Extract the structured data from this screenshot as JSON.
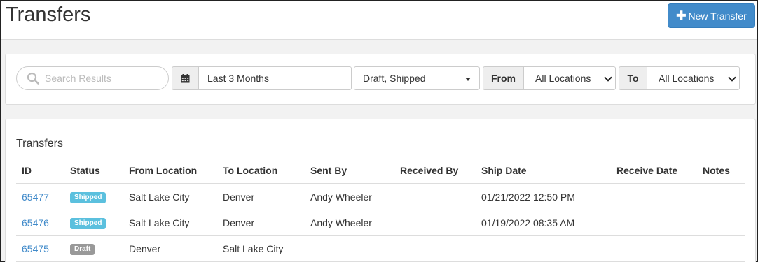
{
  "header": {
    "title": "Transfers",
    "new_button_label": "New Transfer",
    "new_button_icon": "plus-icon"
  },
  "filters": {
    "search_placeholder": "Search Results",
    "date_icon": "calendar-icon",
    "date_range": "Last 3 Months",
    "status": "Draft, Shipped",
    "from_label": "From",
    "from_value": "All Locations",
    "to_label": "To",
    "to_value": "All Locations"
  },
  "table": {
    "title": "Transfers",
    "columns": [
      "ID",
      "Status",
      "From Location",
      "To Location",
      "Sent By",
      "Received By",
      "Ship Date",
      "Receive Date",
      "Notes"
    ],
    "rows": [
      {
        "id": "65477",
        "status": "Shipped",
        "status_color": "#5bc0de",
        "from": "Salt Lake City",
        "to": "Denver",
        "sent_by": "Andy Wheeler",
        "received_by": "",
        "ship_date": "01/21/2022 12:50 PM",
        "receive_date": "",
        "notes": ""
      },
      {
        "id": "65476",
        "status": "Shipped",
        "status_color": "#5bc0de",
        "from": "Salt Lake City",
        "to": "Denver",
        "sent_by": "Andy Wheeler",
        "received_by": "",
        "ship_date": "01/19/2022 08:35 AM",
        "receive_date": "",
        "notes": ""
      },
      {
        "id": "65475",
        "status": "Draft",
        "status_color": "#999999",
        "from": "Denver",
        "to": "Salt Lake City",
        "sent_by": "",
        "received_by": "",
        "ship_date": "",
        "receive_date": "",
        "notes": ""
      }
    ]
  },
  "colors": {
    "primary": "#428bca",
    "link": "#428bca",
    "shipped_badge": "#5bc0de",
    "draft_badge": "#999999"
  }
}
